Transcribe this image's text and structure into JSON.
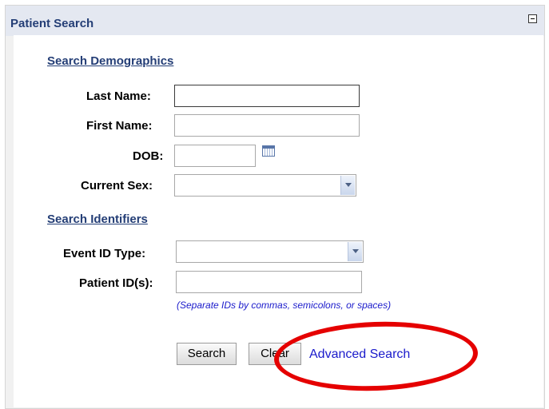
{
  "panel": {
    "title": "Patient Search"
  },
  "demographics": {
    "heading": "Search Demographics",
    "last_name_label": "Last Name:",
    "last_name_value": "",
    "first_name_label": "First Name:",
    "first_name_value": "",
    "dob_label": "DOB:",
    "dob_value": "",
    "current_sex_label": "Current Sex:",
    "current_sex_value": ""
  },
  "identifiers": {
    "heading": "Search Identifiers",
    "event_id_type_label": "Event ID Type:",
    "event_id_type_value": "",
    "patient_ids_label": "Patient ID(s):",
    "patient_ids_value": "",
    "hint": "(Separate IDs by commas, semicolons, or spaces)"
  },
  "actions": {
    "search_label": "Search",
    "clear_label": "Clear",
    "advanced_search_label": "Advanced Search"
  },
  "icons": {
    "collapse": "collapse-icon",
    "calendar": "calendar-icon",
    "dropdown": "chevron-down-icon"
  },
  "colors": {
    "heading": "#243e76",
    "link": "#1a1acb",
    "annotation": "#e50000"
  }
}
